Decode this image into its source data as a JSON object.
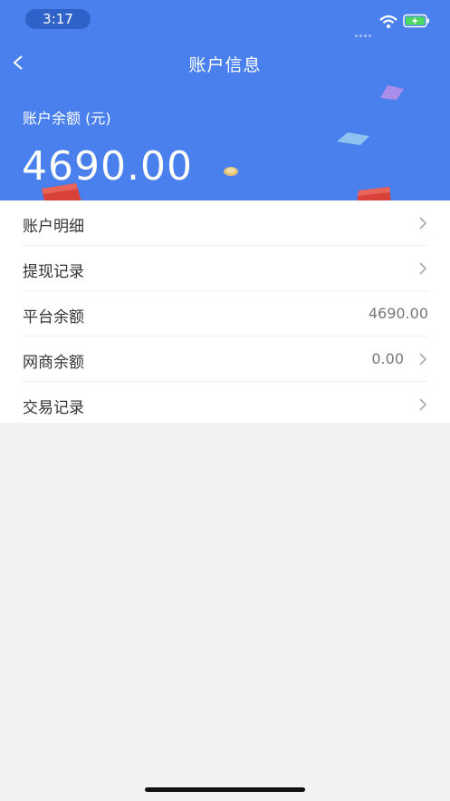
{
  "status": {
    "time": "3:17"
  },
  "nav": {
    "title": "账户信息"
  },
  "balance": {
    "label": "账户余额 (元)",
    "value": "4690.00"
  },
  "menu": [
    {
      "label": "账户明细",
      "value": ""
    },
    {
      "label": "提现记录",
      "value": ""
    },
    {
      "label": "平台余额",
      "value": "4690.00"
    },
    {
      "label": "网商余额",
      "value": "0.00"
    },
    {
      "label": "交易记录",
      "value": ""
    }
  ],
  "colors": {
    "header": "#4a80ed",
    "background": "#f2f2f2",
    "text": "#333333",
    "secondary": "#777777"
  },
  "icons": [
    "back-icon",
    "wifi-icon",
    "battery-icon",
    "chevron-right-icon",
    "red-envelope-icon",
    "coin-icon"
  ]
}
